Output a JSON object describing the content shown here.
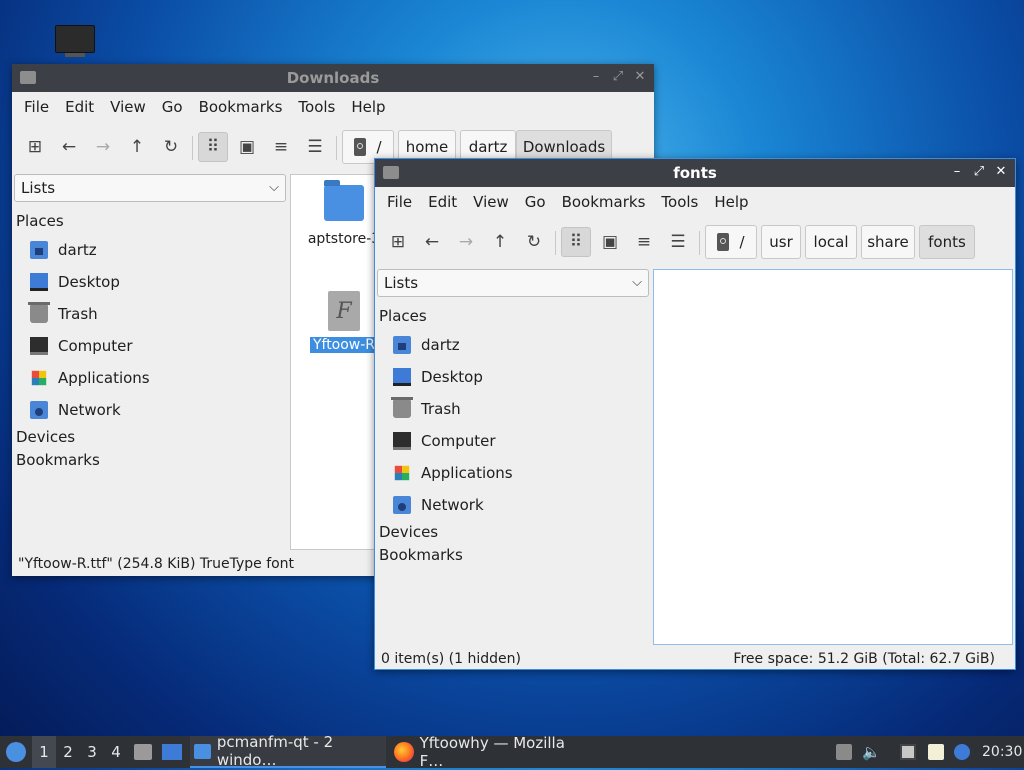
{
  "back_window": {
    "title": "Downloads",
    "menu": [
      "File",
      "Edit",
      "View",
      "Go",
      "Bookmarks",
      "Tools",
      "Help"
    ],
    "path": [
      "/",
      "home",
      "dartz",
      "Downloads"
    ],
    "side_mode": "Lists",
    "places_header": "Places",
    "places": [
      "dartz",
      "Desktop",
      "Trash",
      "Computer",
      "Applications",
      "Network"
    ],
    "devices_header": "Devices",
    "bookmarks_header": "Bookmarks",
    "files": [
      {
        "label": "aptstore-3",
        "kind": "folder"
      },
      {
        "label": "Yftoow-R",
        "kind": "font",
        "selected": true
      }
    ],
    "status": "\"Yftoow-R.ttf\" (254.8 KiB) TrueType font"
  },
  "front_window": {
    "title": "fonts",
    "menu": [
      "File",
      "Edit",
      "View",
      "Go",
      "Bookmarks",
      "Tools",
      "Help"
    ],
    "path": [
      "/",
      "usr",
      "local",
      "share",
      "fonts"
    ],
    "side_mode": "Lists",
    "places_header": "Places",
    "places": [
      "dartz",
      "Desktop",
      "Trash",
      "Computer",
      "Applications",
      "Network"
    ],
    "devices_header": "Devices",
    "bookmarks_header": "Bookmarks",
    "status_left": "0 item(s) (1 hidden)",
    "status_right": "Free space: 51.2 GiB (Total: 62.7 GiB)"
  },
  "taskbar": {
    "workspaces": [
      "1",
      "2",
      "3",
      "4"
    ],
    "active_workspace": "1",
    "tasks": [
      {
        "label": "pcmanfm-qt - 2 windo…",
        "icon": "folder-icon",
        "active": true
      },
      {
        "label": "Yftoowhy — Mozilla F…",
        "icon": "firefox-icon",
        "active": false
      }
    ],
    "clock": "20:30"
  },
  "colors": {
    "titlebar": "#3c3f45",
    "selection": "#3d8ee0",
    "taskbar": "#2e3136",
    "folder": "#4a90e2"
  }
}
